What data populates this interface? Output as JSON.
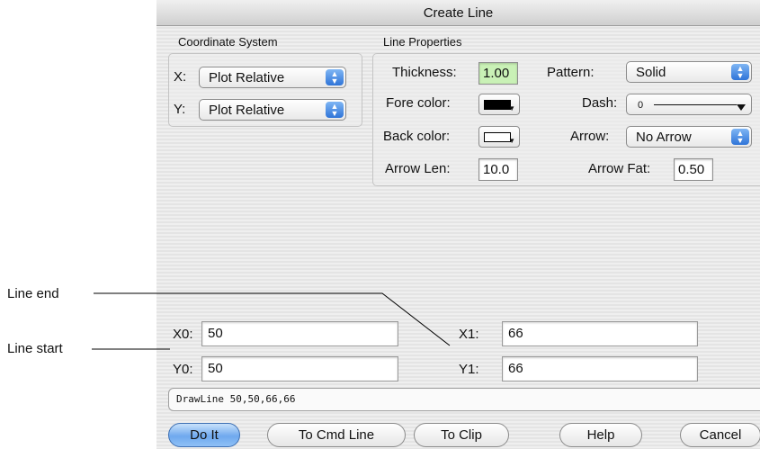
{
  "window": {
    "title": "Create Line"
  },
  "annotations": {
    "line_end": "Line end",
    "line_start": "Line start"
  },
  "coordinate_system": {
    "heading": "Coordinate System",
    "x_label": "X:",
    "x_value": "Plot Relative",
    "y_label": "Y:",
    "y_value": "Plot Relative"
  },
  "line_properties": {
    "heading": "Line Properties",
    "thickness_label": "Thickness:",
    "thickness_value": "1.00",
    "pattern_label": "Pattern:",
    "pattern_value": "Solid",
    "fore_color_label": "Fore color:",
    "fore_color": "#000000",
    "dash_label": "Dash:",
    "dash_value": "0",
    "back_color_label": "Back color:",
    "back_color": "#ffffff",
    "arrow_label": "Arrow:",
    "arrow_value": "No Arrow",
    "arrow_len_label": "Arrow Len:",
    "arrow_len_value": "10.0",
    "arrow_fat_label": "Arrow Fat:",
    "arrow_fat_value": "0.50"
  },
  "coordinates": {
    "x0_label": "X0:",
    "x0_value": "50",
    "y0_label": "Y0:",
    "y0_value": "50",
    "x1_label": "X1:",
    "x1_value": "66",
    "y1_label": "Y1:",
    "y1_value": "66"
  },
  "command": "DrawLine 50,50,66,66",
  "buttons": {
    "do_it": "Do It",
    "to_cmd_line": "To Cmd Line",
    "to_clip": "To Clip",
    "help": "Help",
    "cancel": "Cancel"
  },
  "colors": {
    "default_button": "#6fa9ee",
    "focus_field": "#c9f1b6",
    "popup_arrows": "#2f74d8"
  }
}
